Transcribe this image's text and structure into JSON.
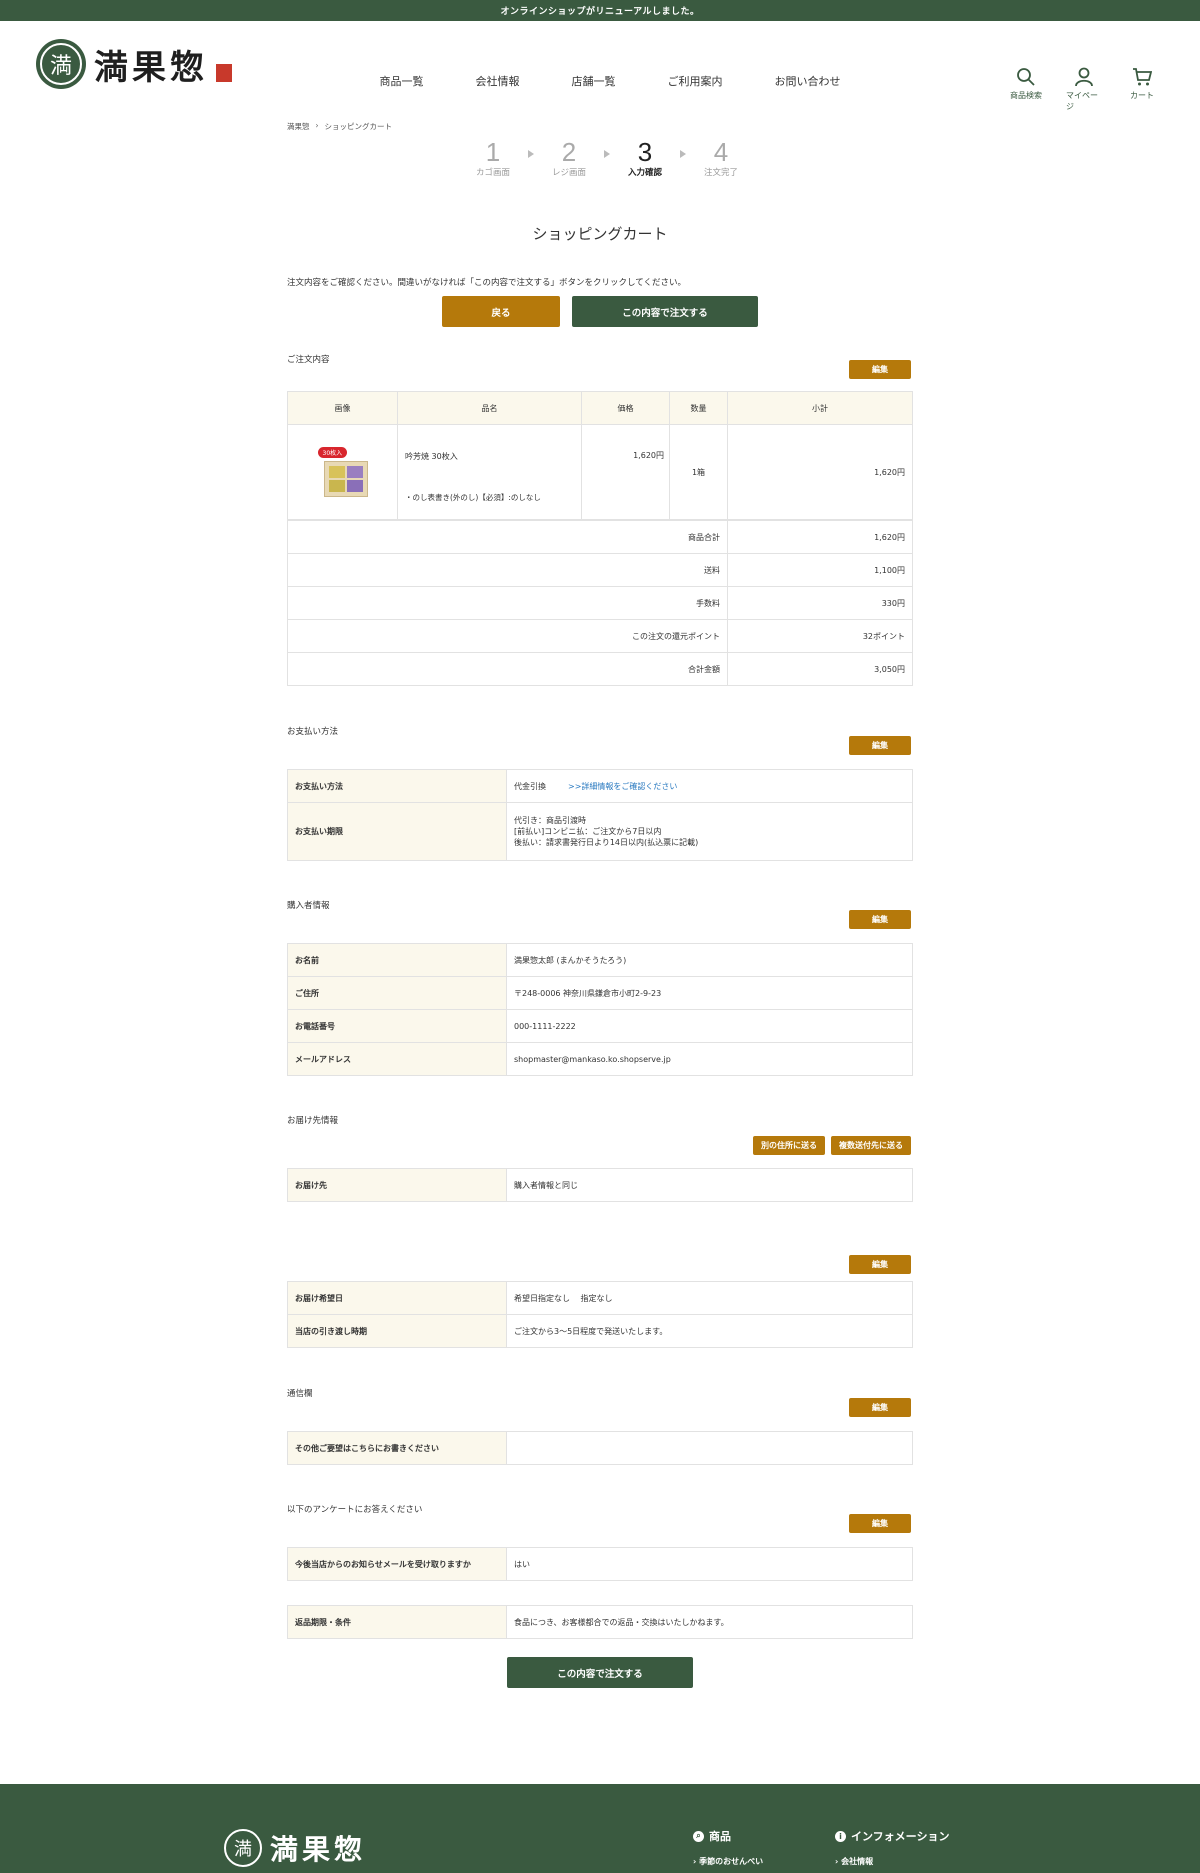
{
  "topbar": "オンラインショップがリニューアルしました。",
  "brand": {
    "name": "満果惣",
    "mark": "満"
  },
  "nav": [
    "商品一覧",
    "会社情報",
    "店舗一覧",
    "ご利用案内",
    "お問い合わせ"
  ],
  "header_icons": [
    {
      "label": "商品検索",
      "icon": "search-icon"
    },
    {
      "label": "マイページ",
      "icon": "user-icon"
    },
    {
      "label": "カート",
      "icon": "cart-icon"
    }
  ],
  "breadcrumb": [
    "満果惣",
    "›",
    "ショッピングカート"
  ],
  "steps": [
    {
      "num": "1",
      "label": "カゴ画面"
    },
    {
      "num": "2",
      "label": "レジ画面"
    },
    {
      "num": "3",
      "label": "入力確認"
    },
    {
      "num": "4",
      "label": "注文完了"
    }
  ],
  "page_title": "ショッピングカート",
  "note": "注文内容をご確認ください。間違いがなければ「この内容で注文する」ボタンをクリックしてください。",
  "buttons": {
    "back": "戻る",
    "order": "この内容で注文する",
    "edit": "編集",
    "other_address": "別の住所に送る",
    "multi_address": "複数送付先に送る"
  },
  "order": {
    "title": "ご注文内容",
    "headers": [
      "画像",
      "品名",
      "価格",
      "数量",
      "小計"
    ],
    "item": {
      "badge": "30枚入",
      "name": "吟芳焼 30枚入",
      "option": "・のし表書き(外のし)【必須】:のしなし",
      "price": "1,620円",
      "qty": "1箱",
      "subtotal": "1,620円"
    },
    "summary": [
      {
        "label": "商品合計",
        "value": "1,620円"
      },
      {
        "label": "送料",
        "value": "1,100円"
      },
      {
        "label": "手数料",
        "value": "330円"
      },
      {
        "label": "この注文の還元ポイント",
        "value": "32ポイント"
      },
      {
        "label": "合計金額",
        "value": "3,050円"
      }
    ]
  },
  "payment": {
    "title": "お支払い方法",
    "method_label": "お支払い方法",
    "method_value": "代金引換",
    "method_link": ">>詳細情報をご確認ください",
    "deadline_label": "お支払い期限",
    "deadline_lines": [
      "代引き：商品引渡時",
      "[前払い]コンビニ払：ご注文から7日以内",
      "後払い：請求書発行日より14日以内(払込票に記載)"
    ]
  },
  "buyer": {
    "title": "購入者情報",
    "rows": [
      {
        "k": "お名前",
        "v": "満果惣太郎 (まんかそうたろう)"
      },
      {
        "k": "ご住所",
        "v": "〒248-0006 神奈川県鎌倉市小町2-9-23"
      },
      {
        "k": "お電話番号",
        "v": "000-1111-2222"
      },
      {
        "k": "メールアドレス",
        "v": "shopmaster@mankaso.ko.shopserve.jp"
      }
    ]
  },
  "delivery": {
    "title": "お届け先情報",
    "k": "お届け先",
    "v": "購入者情報と同じ"
  },
  "schedule": {
    "rows": [
      {
        "k": "お届け希望日",
        "v": "希望日指定なし　 指定なし"
      },
      {
        "k": "当店の引き渡し時期",
        "v": "ご注文から3～5日程度で発送いたします。"
      }
    ]
  },
  "message": {
    "title": "通信欄",
    "k": "その他ご要望はこちらにお書きください",
    "v": ""
  },
  "survey": {
    "title": "以下のアンケートにお答えください",
    "k": "今後当店からのお知らせメールを受け取りますか",
    "v": "はい"
  },
  "returns": {
    "k": "返品期限・条件",
    "v": "食品につき、お客様都合での返品・交換はいたしかねます。"
  },
  "footer": {
    "col1": {
      "title": "商品",
      "link": "季節のおせんべい"
    },
    "col2": {
      "title": "インフォメーション",
      "link": "会社情報"
    }
  },
  "colors": {
    "green": "#3a5a40",
    "gold": "#b5790b",
    "cream": "#fbf8ec"
  }
}
